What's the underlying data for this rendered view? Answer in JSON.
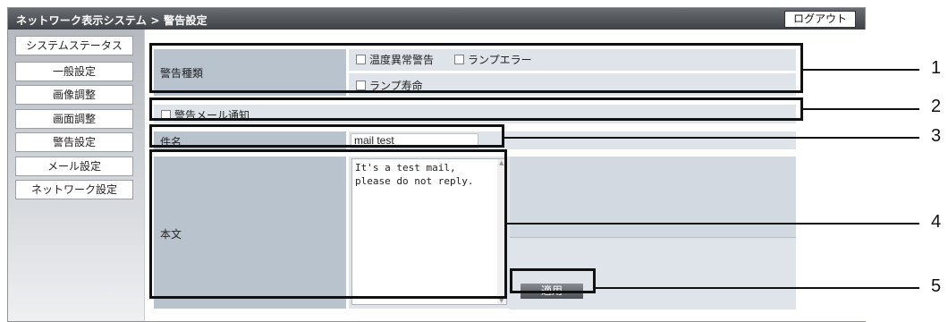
{
  "header": {
    "breadcrumb": "ネットワーク表示システム > 警告設定",
    "logout_label": "ログアウト"
  },
  "sidebar": {
    "items": [
      {
        "label": "システムステータス"
      },
      {
        "label": "一般設定"
      },
      {
        "label": "画像調整"
      },
      {
        "label": "画面調整"
      },
      {
        "label": "警告設定"
      },
      {
        "label": "メール設定"
      },
      {
        "label": "ネットワーク設定"
      }
    ]
  },
  "form": {
    "warning_type": {
      "label": "警告種類",
      "options": [
        "温度異常警告",
        "ランプエラー",
        "ランプ寿命"
      ]
    },
    "mail_notify_label": "警告メール通知",
    "subject": {
      "label": "件名",
      "value": "mail test"
    },
    "body": {
      "label": "本文",
      "value": "It's a test mail,\nplease do not reply."
    },
    "apply_label": "適用"
  },
  "callouts": [
    "1",
    "2",
    "3",
    "4",
    "5"
  ],
  "colors": {
    "header": "#4a4e53",
    "label_cell": "#b9c3ce",
    "value_cell": "#dfe4ea",
    "highlight": "#111111"
  }
}
